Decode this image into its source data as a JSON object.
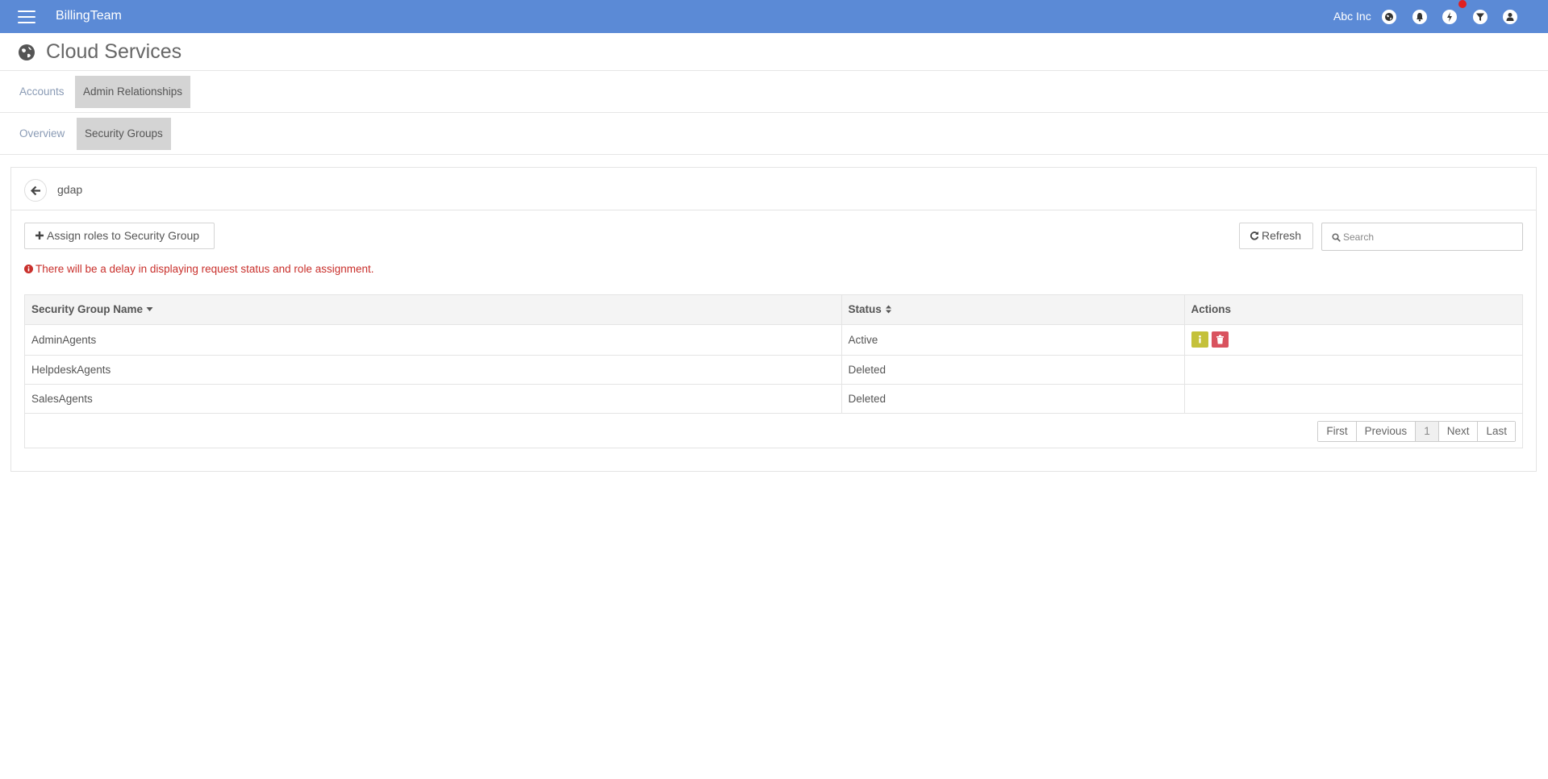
{
  "topbar": {
    "brand": "BillingTeam",
    "company": "Abc Inc",
    "icons": [
      "globe-icon",
      "bell-icon",
      "bolt-icon",
      "filter-icon",
      "user-icon"
    ],
    "accent": "#5b8ad6",
    "notification_color": "#e02020"
  },
  "header": {
    "title": "Cloud Services",
    "icon": "globe-icon"
  },
  "tabs_primary": [
    {
      "label": "Accounts",
      "active": false
    },
    {
      "label": "Admin Relationships",
      "active": true
    }
  ],
  "tabs_secondary": [
    {
      "label": "Overview",
      "active": false
    },
    {
      "label": "Security Groups",
      "active": true
    }
  ],
  "panel": {
    "name": "gdap",
    "assign_label": "Assign roles to Security Group",
    "refresh_label": "Refresh",
    "search_placeholder": "Search",
    "warning": "There will be a delay in displaying request status and role assignment.",
    "warning_color": "#c9302c"
  },
  "table": {
    "columns": [
      "Security Group Name",
      "Status",
      "Actions"
    ],
    "rows": [
      {
        "name": "AdminAgents",
        "status": "Active",
        "actions": [
          "info-icon",
          "trash-icon"
        ]
      },
      {
        "name": "HelpdeskAgents",
        "status": "Deleted",
        "actions": []
      },
      {
        "name": "SalesAgents",
        "status": "Deleted",
        "actions": []
      }
    ]
  },
  "pagination": {
    "first": "First",
    "previous": "Previous",
    "current": "1",
    "next": "Next",
    "last": "Last"
  }
}
